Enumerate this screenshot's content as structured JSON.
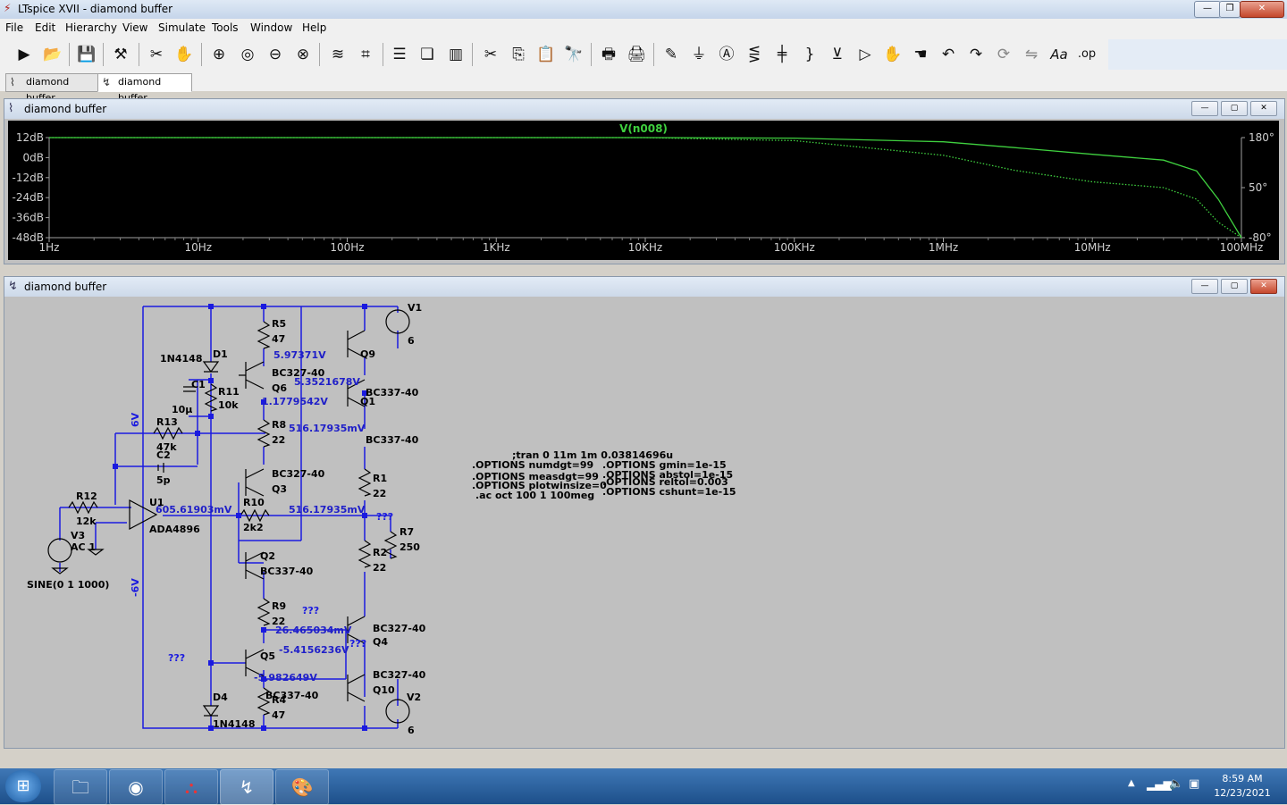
{
  "window": {
    "title": "LTspice XVII - diamond buffer"
  },
  "menu": [
    "File",
    "Edit",
    "Hierarchy",
    "View",
    "Simulate",
    "Tools",
    "Window",
    "Help"
  ],
  "toolbar_icons": [
    "run-icon",
    "open-icon",
    "save-icon",
    "control-panel-icon",
    "halt-icon",
    "pan-icon",
    "zoom-in-icon",
    "zoom-fit-icon",
    "zoom-out-icon",
    "zoom-cancel-icon",
    "plot-settings-icon",
    "autorange-icon",
    "tile-horizontal-icon",
    "cascade-icon",
    "tile-vertical-icon",
    "cut-icon",
    "copy-icon",
    "paste-icon",
    "find-icon",
    "print-icon",
    "print-setup-icon",
    "draw-wire-icon",
    "ground-icon",
    "label-net-icon",
    "resistor-icon",
    "capacitor-icon",
    "inductor-icon",
    "diode-icon",
    "component-icon",
    "move-icon",
    "drag-icon",
    "undo-icon",
    "redo-icon",
    "rotate-icon",
    "mirror-icon",
    "text-icon",
    "spice-directive-icon"
  ],
  "tabs": [
    {
      "label": "diamond buffer",
      "active": false
    },
    {
      "label": "diamond buffer",
      "active": true
    }
  ],
  "plot_window": {
    "title": "diamond buffer",
    "trace_label": "V(n008)",
    "y_ticks": [
      "12dB",
      "0dB",
      "-12dB",
      "-24dB",
      "-36dB",
      "-48dB"
    ],
    "y2_ticks": [
      "180°",
      "50°",
      "-80°"
    ],
    "x_ticks": [
      "1Hz",
      "10Hz",
      "100Hz",
      "1KHz",
      "10KHz",
      "100KHz",
      "1MHz",
      "10MHz",
      "100MHz"
    ]
  },
  "chart_data": {
    "type": "line",
    "title": "V(n008)",
    "xscale": "log",
    "xlim": [
      1,
      100000000
    ],
    "ylim": [
      -48,
      12
    ],
    "y2lim": [
      -80,
      180
    ],
    "grid": false,
    "series": [
      {
        "name": "V(n008)",
        "axis": "magnitude_dB",
        "style": "solid",
        "color": "#3fd03f",
        "x": [
          1,
          10000,
          100000,
          1000000,
          3000000,
          10000000,
          30000000,
          50000000,
          70000000,
          100000000
        ],
        "y": [
          12,
          12,
          11.7,
          9.5,
          6,
          2,
          -1.5,
          -8,
          -25,
          -48
        ]
      },
      {
        "name": "V(n008) phase",
        "axis": "phase_deg",
        "style": "dotted",
        "color": "#3fd03f",
        "x": [
          1,
          10000,
          100000,
          1000000,
          3000000,
          10000000,
          30000000,
          50000000,
          70000000,
          100000000
        ],
        "y": [
          180,
          180,
          172,
          134,
          95,
          65,
          50,
          20,
          -40,
          -80
        ]
      }
    ]
  },
  "schematic_window": {
    "title": "diamond buffer",
    "directives": [
      ";tran 0 11m 1m 0.03814696u",
      ".OPTIONS numdgt=99",
      ".OPTIONS measdgt=99",
      ".OPTIONS plotwinsize=0",
      ".ac oct 100 1 100meg",
      ".OPTIONS gmin=1e-15",
      ".OPTIONS abstol=1e-15",
      ".OPTIONS reltol=0.003",
      ".OPTIONS cshunt=1e-15"
    ],
    "labels": {
      "v1": "V1",
      "v1_val": "6",
      "v2": "V2",
      "v2_val": "6",
      "v3": "V3",
      "v3_ac": "AC 1",
      "v3_sine": "SINE(0 1 1000)",
      "r5": "R5",
      "r5_val": "47",
      "r11": "R11",
      "r11_val": "10k",
      "r8": "R8",
      "r8_val": "22",
      "r13": "R13",
      "r13_val": "47k",
      "r12": "R12",
      "r12_val": "12k",
      "r10": "R10",
      "r10_val": "2k2",
      "r1": "R1",
      "r1_val": "22",
      "r2": "R2",
      "r2_val": "22",
      "r7": "R7",
      "r7_val": "250",
      "r9": "R9",
      "r9_val": "22",
      "r4": "R4",
      "r4_val": "47",
      "c1": "C1",
      "c1_val": "10µ",
      "c2": "C2",
      "c2_val": "5p",
      "d1": "D1",
      "d1_part": "1N4148",
      "d4": "D4",
      "d4_part": "1N4148",
      "q9": "Q9",
      "q6": "Q6",
      "q1": "Q1",
      "q3": "Q3",
      "q2": "Q2",
      "q4": "Q4",
      "q5": "Q5",
      "q10": "Q10",
      "bc327_q6": "BC327-40",
      "bc337_q1": "BC337-40",
      "bc337_q9": "BC337-40",
      "bc327_q3": "BC327-40",
      "bc337_q2": "BC337-40",
      "bc327_q4": "BC327-40",
      "bc327_q10": "BC327-40",
      "bc337_q5": "BC337-40",
      "u1": "U1",
      "u1_part": "ADA4896",
      "net_6v": "6V",
      "net_m6v": "-6V",
      "unk1": "???",
      "unk2": "???",
      "unk3": "???",
      "unk4": "???"
    },
    "op_values": [
      "5.97371V",
      "5.3521678V",
      "1.1779542V",
      "516.17935mV",
      "605.61903mV",
      "516.17935mV",
      "26.465034mV",
      "-5.4156236V",
      "-5.982649V"
    ]
  },
  "taskbar": {
    "apps": [
      "start-orb-icon",
      "file-explorer-icon",
      "firefox-icon",
      "acrobat-icon",
      "ltspice-icon",
      "paint-icon"
    ],
    "time": "8:59 AM",
    "date": "12/23/2021"
  },
  "colors": {
    "trace": "#3fd03f",
    "op_value": "#1f1fc8",
    "wire": "#1a1adf",
    "background_schematic": "#c0c0c0",
    "plot_bg": "#000000"
  }
}
